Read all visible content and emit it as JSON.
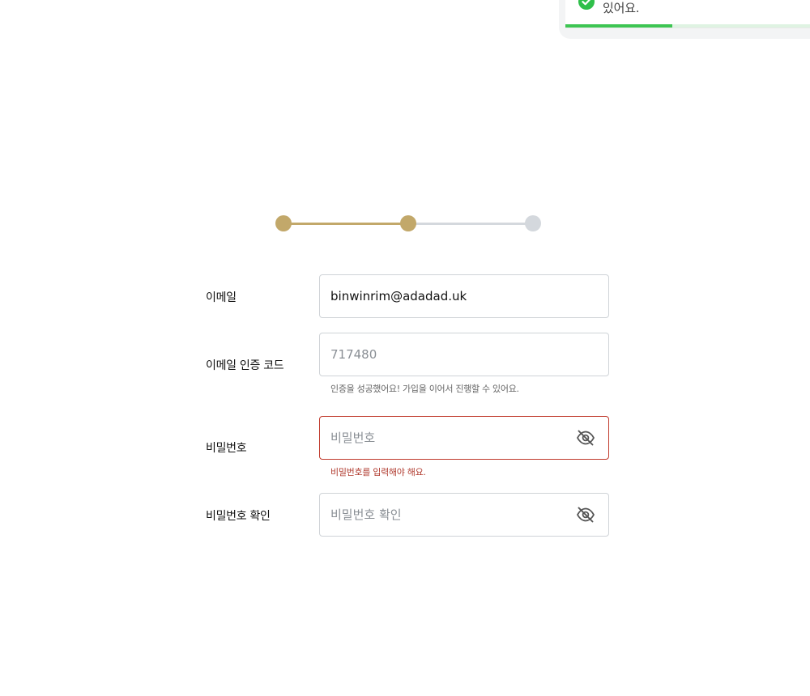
{
  "toast": {
    "message": "있어요.",
    "progress_fraction": 0.4
  },
  "stepper": {
    "current_step": 2,
    "total_steps": 3
  },
  "form": {
    "email": {
      "label": "이메일",
      "value": "binwinrim@adadad.uk"
    },
    "email_code": {
      "label": "이메일 인증 코드",
      "value": "717480",
      "help": "인증을 성공했어요! 가입을 이어서 진행할 수 있어요."
    },
    "password": {
      "label": "비밀번호",
      "placeholder": "비밀번호",
      "error": "비밀번호를 입력해야 해요."
    },
    "password_confirm": {
      "label": "비밀번호 확인",
      "placeholder": "비밀번호 확인"
    }
  },
  "colors": {
    "accent": "#c2a86a",
    "inactive": "#d4d8dd",
    "error": "#c0392b",
    "success": "#2fbf4a"
  }
}
